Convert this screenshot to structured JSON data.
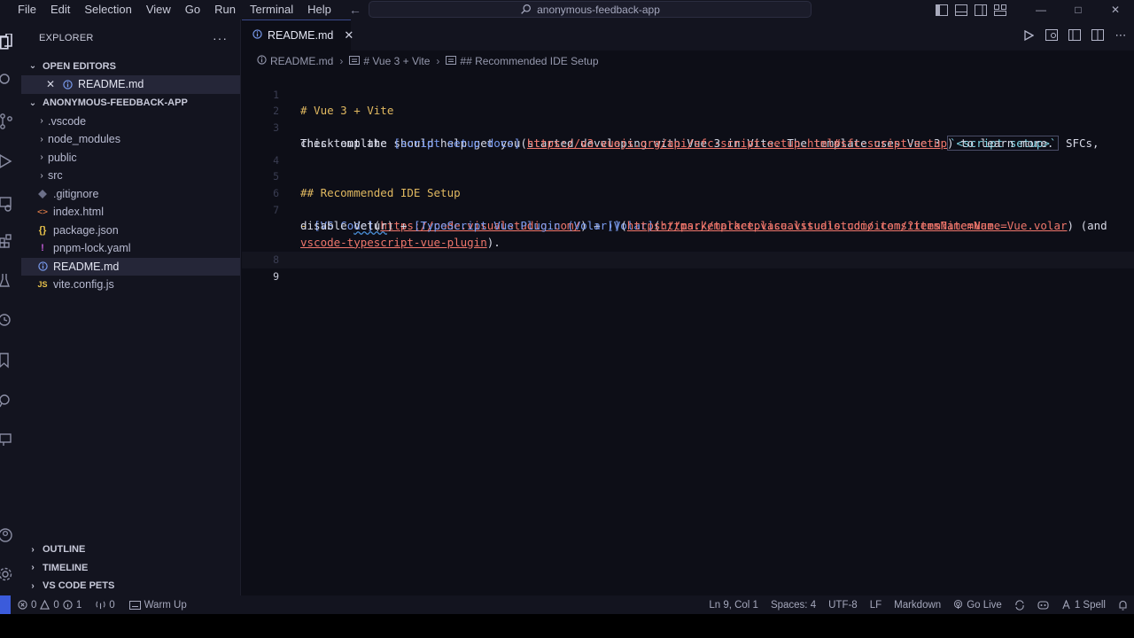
{
  "menu": [
    "File",
    "Edit",
    "Selection",
    "View",
    "Go",
    "Run",
    "Terminal",
    "Help"
  ],
  "command_center": {
    "text": "anonymous-feedback-app"
  },
  "sidebar": {
    "title": "EXPLORER",
    "more": "···",
    "open_editors": {
      "label": "OPEN EDITORS",
      "file": "README.md"
    },
    "project": {
      "label": "ANONYMOUS-FEEDBACK-APP"
    },
    "items": [
      {
        "label": ".vscode",
        "icon": "chevron-right"
      },
      {
        "label": "node_modules",
        "icon": "chevron-right"
      },
      {
        "label": "public",
        "icon": "chevron-right"
      },
      {
        "label": "src",
        "icon": "chevron-right"
      },
      {
        "label": ".gitignore",
        "icon": "git-icon"
      },
      {
        "label": "index.html",
        "icon": "html-icon"
      },
      {
        "label": "package.json",
        "icon": "json-icon"
      },
      {
        "label": "pnpm-lock.yaml",
        "icon": "yaml-icon"
      },
      {
        "label": "README.md",
        "icon": "info-icon"
      },
      {
        "label": "vite.config.js",
        "icon": "js-icon"
      }
    ],
    "bottom_sections": [
      "OUTLINE",
      "TIMELINE",
      "VS CODE PETS"
    ]
  },
  "tab": {
    "label": "README.md"
  },
  "breadcrumb": [
    "README.md",
    "# Vue 3 + Vite",
    "## Recommended IDE Setup"
  ],
  "editor": {
    "line_numbers": [
      "1",
      "2",
      "3",
      "4",
      "5",
      "6",
      "7",
      "8",
      "9"
    ],
    "line1": "# Vue 3 + Vite",
    "line3a_text": "This template should help get you started developing with Vue 3 in Vite. The template uses Vue 3 ",
    "line3a_code": "`<script setup>`",
    "line3a_end": " SFCs,",
    "line3b_pre": "check out the ",
    "line3b_link": "[script setup docs]",
    "line3b_url": "https://v3.vuejs.org/api/sfc-script-setup.html#sfc-script-setup",
    "line3b_end": " to learn more.",
    "line5": "## Recommended IDE Setup",
    "line7a_dash": "- ",
    "line7a_link1": "[VS Code]",
    "line7a_url1": "https://code.visualstudio.com/",
    "line7a_plus": " + ",
    "line7a_link2": "[Volar]",
    "line7a_url2": "https://marketplace.visualstudio.com/items?itemName=Vue.volar",
    "line7a_end": " (and",
    "line7b_pre": "disable ",
    "line7b_vetur": "Vetur",
    "line7b_mid": ") + ",
    "line7b_link": "[TypeScript Vue Plugin (Volar)]",
    "line7b_url": "https://marketplace.visualstudio.com/items?itemName=Vue.",
    "line7c_url": "vscode-typescript-vue-plugin",
    "line7c_end": ")."
  },
  "status": {
    "errors": "0",
    "warnings": "0",
    "info": "1",
    "ports": "0",
    "warmup": "Warm Up",
    "position": "Ln 9, Col 1",
    "spaces": "Spaces: 4",
    "encoding": "UTF-8",
    "eol": "LF",
    "language": "Markdown",
    "golive": "Go Live",
    "spell": "1 Spell"
  },
  "colors": {
    "accent": "#3b5bdb",
    "heading": "#e0b860",
    "link": "#7a9cf0",
    "url": "#f0766b"
  }
}
